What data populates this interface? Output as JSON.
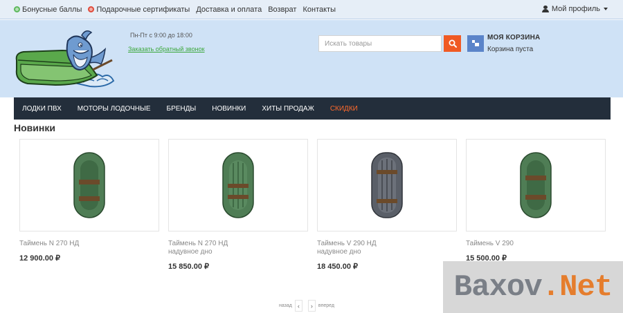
{
  "topbar": {
    "links": [
      "Бонусные баллы",
      "Подарочные сертификаты",
      "Доставка и оплата",
      "Возврат",
      "Контакты"
    ],
    "profile": "Мой профиль"
  },
  "header": {
    "hours": "Пн-Пт с 9:00 до 18:00",
    "callback": "Заказать обратный звонок",
    "search_placeholder": "Искать товары",
    "cart_title": "МОЯ КОРЗИНА",
    "cart_status": "Корзина пуста"
  },
  "nav": {
    "items": [
      "ЛОДКИ ПВХ",
      "МОТОРЫ ЛОДОЧНЫЕ",
      "БРЕНДЫ",
      "НОВИНКИ",
      "ХИТЫ ПРОДАЖ",
      "СКИДКИ"
    ]
  },
  "section": {
    "title": "Новинки"
  },
  "products": [
    {
      "name": "Таймень N 270 НД",
      "price": "12 900.00 ₽",
      "color": "#4f7d55"
    },
    {
      "name": "Таймень N 270 НД\nнадувное дно",
      "price": "15 850.00 ₽",
      "color": "#4f7d55"
    },
    {
      "name": "Таймень V 290 НД\nнадувное дно",
      "price": "18 450.00 ₽",
      "color": "#5a5f68"
    },
    {
      "name": "Таймень V 290",
      "price": "15 500.00 ₽",
      "color": "#4f7d55"
    }
  ],
  "pager": {
    "prev": "назад",
    "next": "вперед"
  },
  "watermark": {
    "part1": "Baxov",
    "part2": ".Net"
  },
  "colors": {
    "accent": "#f05a24",
    "nav_bg": "#232e3b",
    "header_bg": "#cfe2f6"
  }
}
